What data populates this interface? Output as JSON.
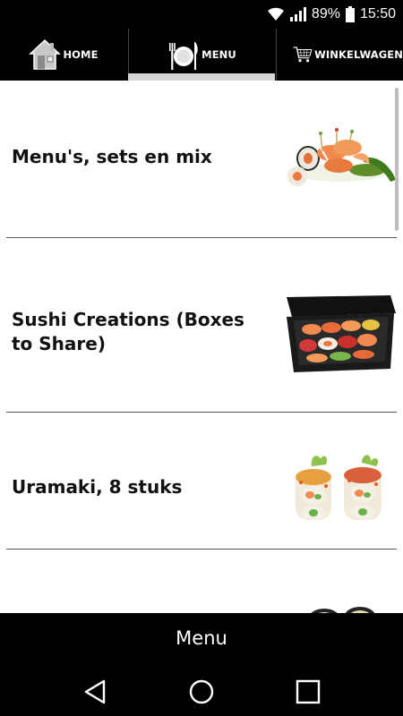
{
  "status_bar": {
    "battery_percent": "89%",
    "time": "15:50",
    "icons": [
      "wifi-icon",
      "signal-icon",
      "battery-icon"
    ]
  },
  "tabs": [
    {
      "label": "HOME",
      "icon": "house-icon",
      "active": false
    },
    {
      "label": "MENU",
      "icon": "plate-cutlery-icon",
      "active": true
    },
    {
      "label": "WINKELWAGEN",
      "icon": "shopping-cart-icon",
      "active": false
    }
  ],
  "menu_items": [
    {
      "title": "Menu's, sets en mix",
      "image": "sushi-mix-photo"
    },
    {
      "title": "Sushi Creations (Boxes to Share)",
      "image": "sushi-box-photo"
    },
    {
      "title": "Uramaki, 8 stuks",
      "image": "uramaki-photo"
    },
    {
      "title": "",
      "image": "sushi-partial-photo"
    }
  ],
  "bottom_bar": {
    "label": "Menu"
  },
  "nav_bar": {
    "buttons": [
      "back-icon",
      "home-circle-icon",
      "recents-square-icon"
    ]
  },
  "colors": {
    "bar_background": "#000000",
    "active_tab_indicator": "#d6d6d6",
    "list_background": "#ffffff",
    "divider": "#555555"
  }
}
